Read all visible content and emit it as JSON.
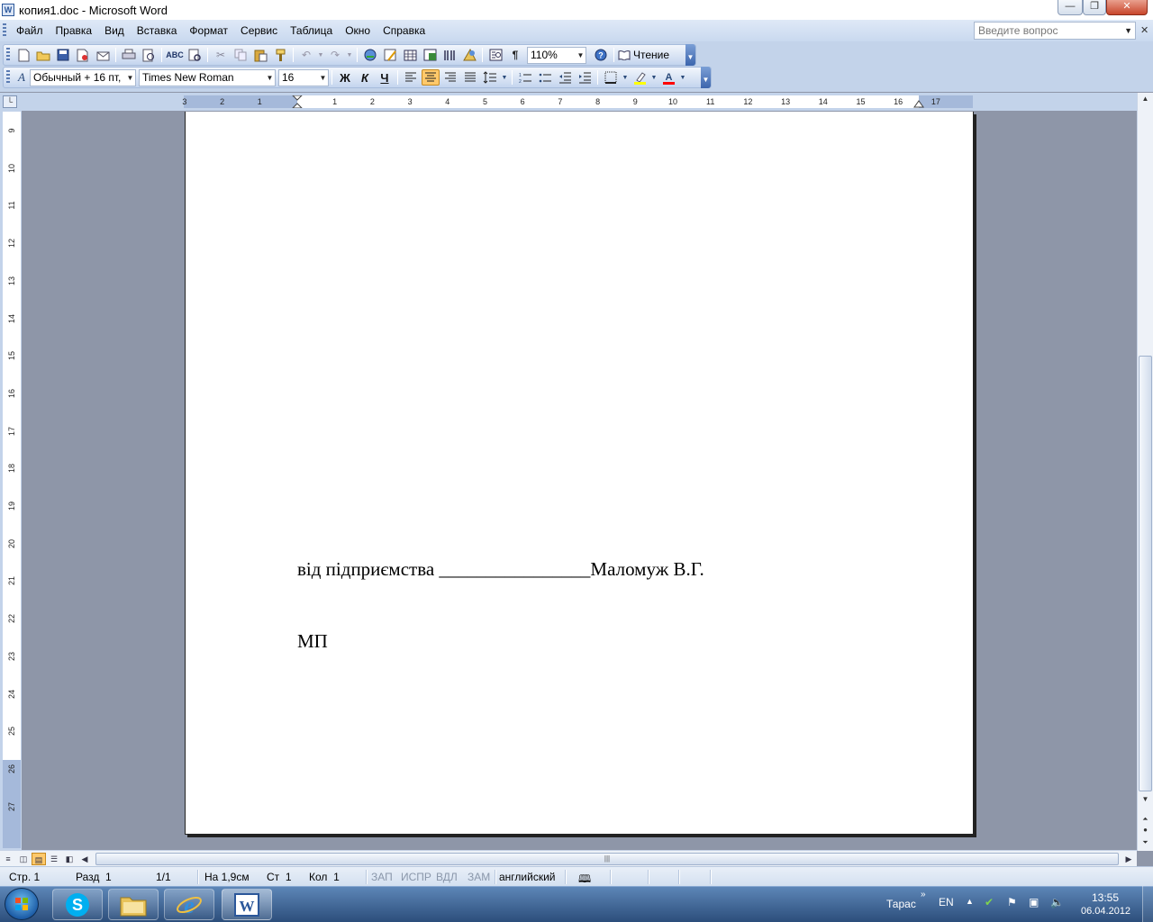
{
  "window": {
    "title": "копия1.doc - Microsoft Word",
    "app_icon": "W",
    "minimize_glyph": "—",
    "restore_glyph": "❐",
    "close_glyph": "✕"
  },
  "menu": {
    "items": [
      "Файл",
      "Правка",
      "Вид",
      "Вставка",
      "Формат",
      "Сервис",
      "Таблица",
      "Окно",
      "Справка"
    ],
    "help_placeholder": "Введите вопрос",
    "close_doc_glyph": "✕"
  },
  "toolbar_standard": {
    "icons": [
      "new-document",
      "open",
      "save",
      "permission",
      "print",
      "print-preview",
      "spelling",
      "research",
      "cut",
      "copy",
      "paste",
      "format-painter",
      "undo",
      "redo",
      "hyperlink",
      "tables-borders",
      "insert-table",
      "insert-excel",
      "columns",
      "drawing",
      "document-map",
      "show-hide"
    ],
    "zoom": "110%",
    "read_label": "Чтение"
  },
  "toolbar_format": {
    "style": "Обычный + 16 пт,",
    "font": "Times New Roman",
    "size": "16",
    "bold": "Ж",
    "italic": "К",
    "underline": "Ч",
    "align_selected": "center",
    "highlight_color": "#ffff00",
    "font_color": "#ff0000"
  },
  "ruler": {
    "h_labels": [
      "3",
      "2",
      "1",
      "",
      "1",
      "2",
      "3",
      "4",
      "5",
      "6",
      "7",
      "8",
      "9",
      "10",
      "11",
      "12",
      "13",
      "14",
      "15",
      "16",
      "17"
    ],
    "v_labels": [
      "9",
      "10",
      "11",
      "12",
      "13",
      "14",
      "15",
      "16",
      "17",
      "18",
      "19",
      "20",
      "21",
      "22",
      "23",
      "24",
      "25",
      "26",
      "27"
    ]
  },
  "document": {
    "line1": "від підприємства ________________Маломуж В.Г.",
    "line2": "МП"
  },
  "status": {
    "page": "Стр. 1",
    "section": "Разд  1",
    "pages": "1/1",
    "at": "На 1,9см",
    "line": "Ст  1",
    "col": "Кол  1",
    "rec": "ЗАП",
    "trk": "ИСПР",
    "ext": "ВДЛ",
    "ovr": "ЗАМ",
    "lang": "английский"
  },
  "taskbar": {
    "user": "Тарас",
    "lang": "EN",
    "time": "13:55",
    "date": "06.04.2012",
    "apps": [
      "skype",
      "explorer",
      "internet-explorer",
      "word"
    ]
  }
}
